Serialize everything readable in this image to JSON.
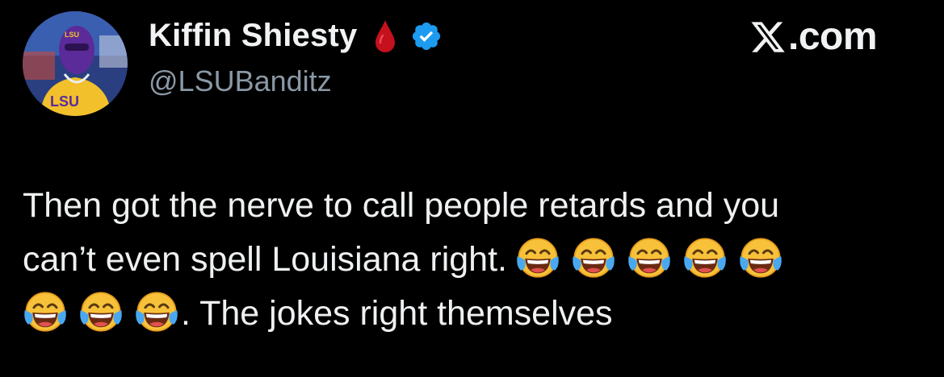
{
  "author": {
    "display_name": "Kiffin Shiesty",
    "handle": "@LSUBanditz",
    "avatar_text": "LSU",
    "avatar_mask_text": "LSU"
  },
  "badges": {
    "blood_drop_icon": "drop-of-blood-emoji",
    "verified_icon": "verified-badge",
    "verified_color": "#1d9bf0"
  },
  "brand": {
    "logo_icon": "x-logo",
    "text": ".com"
  },
  "tweet": {
    "line1": "Then got the nerve to call people retards and you",
    "line2": "can’t even spell Louisiana right.",
    "line3_end": ". The jokes right themselves",
    "emoji_name": "face-with-tears-of-joy-emoji",
    "emoji_count_line2": 5,
    "emoji_count_line3": 3
  },
  "colors": {
    "background": "#000000",
    "text": "#e7e9ea",
    "secondary": "#8b98a5"
  }
}
